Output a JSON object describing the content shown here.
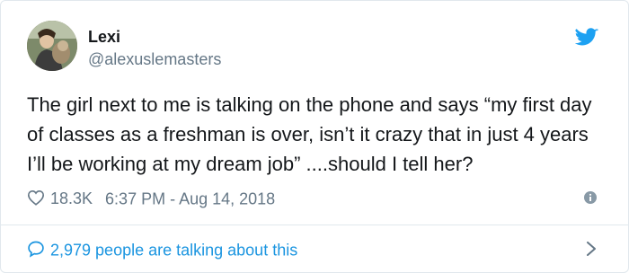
{
  "user": {
    "display_name": "Lexi",
    "handle": "@alexuslemasters"
  },
  "tweet": {
    "text": "The girl next to me is talking on the phone and says “my first day\nof classes as a freshman is over, isn’t it crazy that in just 4 years\nI’ll be working at my dream job” ....should I tell her?"
  },
  "meta": {
    "likes": "18.3K",
    "timestamp": "6:37 PM - Aug 14, 2018"
  },
  "footer": {
    "conversation_text": "2,979 people are talking about this"
  },
  "icons": {
    "brand": "twitter-bird-icon",
    "like": "heart-icon",
    "info": "info-icon",
    "reply": "speech-bubble-icon",
    "more": "chevron-right-icon"
  },
  "colors": {
    "twitter_blue": "#1da1f2",
    "link_blue": "#1b95e0",
    "secondary_text": "#657786",
    "primary_text": "#14171a",
    "border": "#e1e8ed"
  }
}
